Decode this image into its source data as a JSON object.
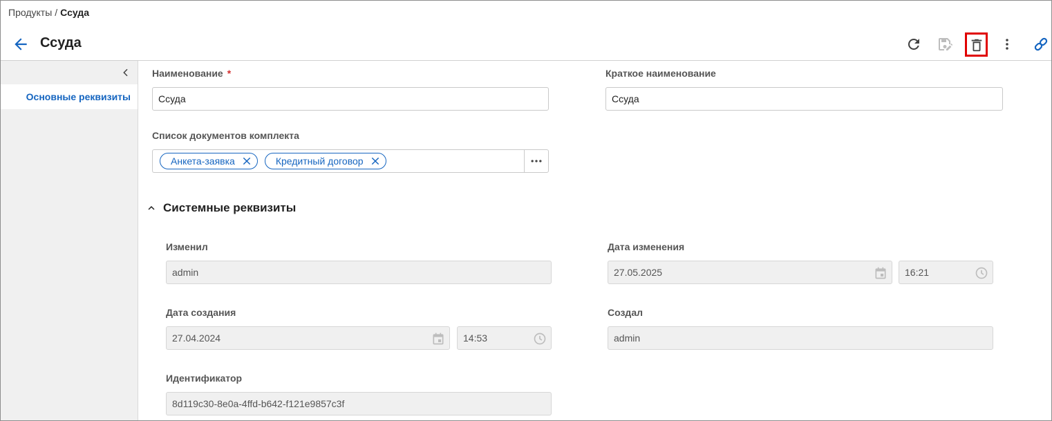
{
  "breadcrumb": {
    "parent": "Продукты",
    "separator": "/",
    "current": "Ссуда"
  },
  "header": {
    "title": "Ссуда",
    "back_icon": "arrow-left-icon",
    "toolbar": [
      {
        "name": "refresh",
        "icon": "refresh-icon"
      },
      {
        "name": "save-edit",
        "icon": "save-edit-icon",
        "disabled": true
      },
      {
        "name": "delete",
        "icon": "trash-icon",
        "highlighted": true,
        "highlight_color": "#e00000"
      },
      {
        "name": "more",
        "icon": "more-vertical-icon"
      },
      {
        "name": "link",
        "icon": "link-icon"
      }
    ]
  },
  "sidebar": {
    "collapse_icon": "chevron-left-icon",
    "items": [
      {
        "label": "Основные реквизиты",
        "active": true
      }
    ]
  },
  "form": {
    "name": {
      "label": "Наименование",
      "required_mark": "*",
      "value": "Ссуда"
    },
    "short_name": {
      "label": "Краткое наименование",
      "value": "Ссуда"
    },
    "documents": {
      "label": "Список документов комплекта",
      "chips": [
        "Анкета-заявка",
        "Кредитный договор"
      ]
    }
  },
  "system_section": {
    "title": "Системные реквизиты",
    "expanded": true,
    "changed_by": {
      "label": "Изменил",
      "value": "admin"
    },
    "changed_date": {
      "label": "Дата изменения",
      "date": "27.05.2025",
      "time": "16:21"
    },
    "created_date": {
      "label": "Дата создания",
      "date": "27.04.2024",
      "time": "14:53"
    },
    "created_by": {
      "label": "Создал",
      "value": "admin"
    },
    "identifier": {
      "label": "Идентификатор",
      "value": "8d119c30-8e0a-4ffd-b642-f121e9857c3f"
    }
  },
  "colors": {
    "accent": "#1565c0",
    "required": "#d32f2f",
    "highlight": "#e00000",
    "readonly_bg": "#f0f0f0",
    "sidebar_bg": "#f0f0f0"
  }
}
